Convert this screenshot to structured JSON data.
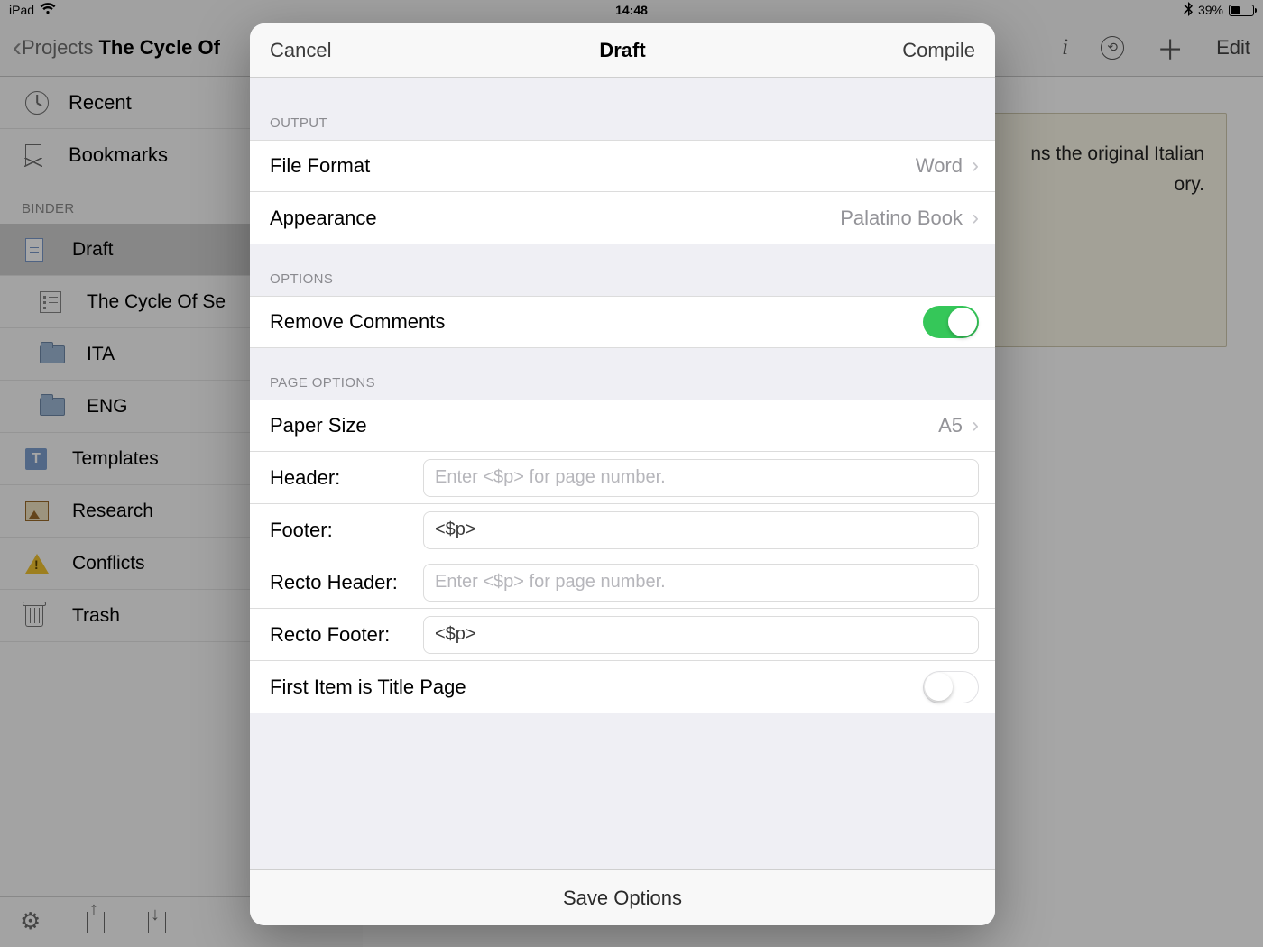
{
  "status": {
    "device": "iPad",
    "time": "14:48",
    "battery_pct": "39%"
  },
  "nav": {
    "back_label": "Projects",
    "title": "The Cycle Of",
    "edit": "Edit"
  },
  "sidebar": {
    "recent": "Recent",
    "bookmarks": "Bookmarks",
    "binder_header": "BINDER",
    "items": [
      {
        "icon": "doc",
        "label": "Draft",
        "selected": true
      },
      {
        "icon": "outline",
        "label": "The Cycle Of Se",
        "indent": true
      },
      {
        "icon": "folder",
        "label": "ITA",
        "indent": true
      },
      {
        "icon": "folder",
        "label": "ENG",
        "indent": true
      },
      {
        "icon": "t",
        "label": "Templates"
      },
      {
        "icon": "pic",
        "label": "Research"
      },
      {
        "icon": "warn",
        "label": "Conflicts"
      },
      {
        "icon": "trash",
        "label": "Trash"
      }
    ]
  },
  "sticky": {
    "line1": "ns the original Italian",
    "line2": "ory."
  },
  "modal": {
    "cancel": "Cancel",
    "title": "Draft",
    "compile": "Compile",
    "output_header": "OUTPUT",
    "file_format_label": "File Format",
    "file_format_value": "Word",
    "appearance_label": "Appearance",
    "appearance_value": "Palatino Book",
    "options_header": "OPTIONS",
    "remove_comments_label": "Remove Comments",
    "remove_comments_on": true,
    "page_options_header": "PAGE OPTIONS",
    "paper_size_label": "Paper Size",
    "paper_size_value": "A5",
    "header_label": "Header:",
    "header_value": "",
    "header_placeholder": "Enter <$p> for page number.",
    "footer_label": "Footer:",
    "footer_value": "<$p>",
    "recto_header_label": "Recto Header:",
    "recto_header_value": "",
    "recto_header_placeholder": "Enter <$p> for page number.",
    "recto_footer_label": "Recto Footer:",
    "recto_footer_value": "<$p>",
    "first_item_label": "First Item is Title Page",
    "first_item_on": false,
    "save_options": "Save Options"
  }
}
